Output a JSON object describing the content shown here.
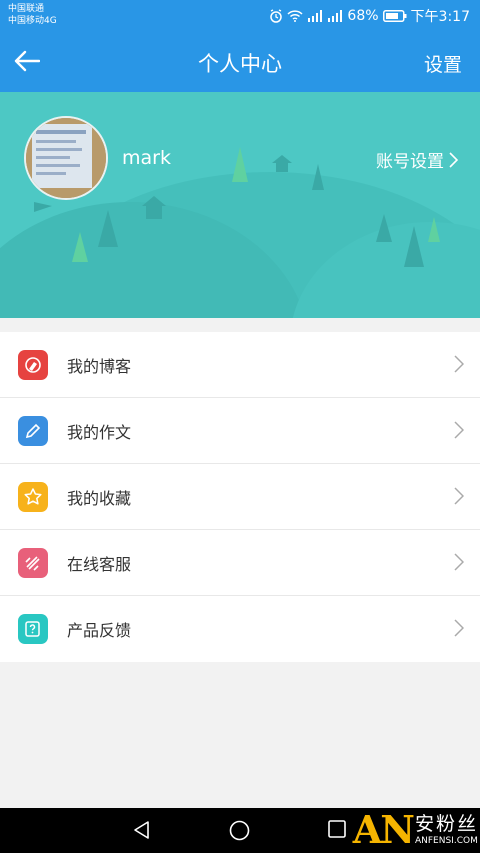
{
  "status_bar": {
    "carrier_1": "中国联通",
    "carrier_2": "中国移动4G",
    "battery": "68%",
    "time": "下午3:17"
  },
  "header": {
    "title": "个人中心",
    "settings_label": "设置"
  },
  "profile": {
    "username": "mark",
    "account_settings_label": "账号设置"
  },
  "menu": {
    "items": [
      {
        "label": "我的博客",
        "icon": "blog-icon",
        "color": "#e64340"
      },
      {
        "label": "我的作文",
        "icon": "pencil-icon",
        "color": "#3a8fe0"
      },
      {
        "label": "我的收藏",
        "icon": "star-icon",
        "color": "#f7b21b"
      },
      {
        "label": "在线客服",
        "icon": "customer-service-icon",
        "color": "#e8607a"
      },
      {
        "label": "产品反馈",
        "icon": "feedback-icon",
        "color": "#29c7c2"
      }
    ]
  },
  "watermark": {
    "logo": "AN",
    "cn": "安粉丝",
    "en": "ANFENSI.COM"
  },
  "colors": {
    "primary": "#2996e6",
    "banner": "#4dc8c4"
  }
}
